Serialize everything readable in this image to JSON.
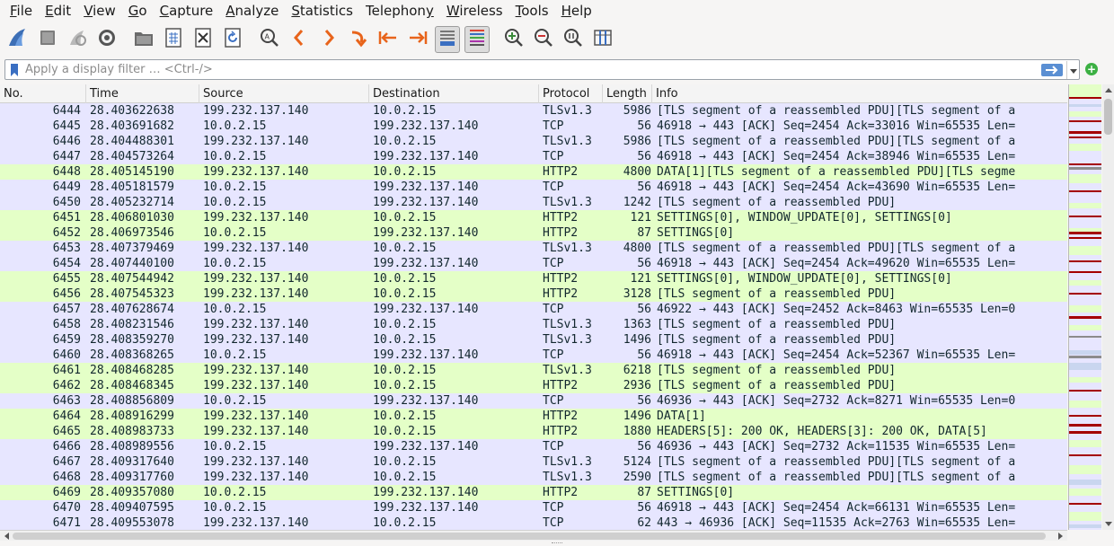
{
  "menu": [
    {
      "pre": "",
      "mn": "F",
      "post": "ile"
    },
    {
      "pre": "",
      "mn": "E",
      "post": "dit"
    },
    {
      "pre": "",
      "mn": "V",
      "post": "iew"
    },
    {
      "pre": "",
      "mn": "G",
      "post": "o"
    },
    {
      "pre": "",
      "mn": "C",
      "post": "apture"
    },
    {
      "pre": "",
      "mn": "A",
      "post": "nalyze"
    },
    {
      "pre": "",
      "mn": "S",
      "post": "tatistics"
    },
    {
      "pre": "Telephon",
      "mn": "y",
      "post": ""
    },
    {
      "pre": "",
      "mn": "W",
      "post": "ireless"
    },
    {
      "pre": "",
      "mn": "T",
      "post": "ools"
    },
    {
      "pre": "",
      "mn": "H",
      "post": "elp"
    }
  ],
  "filter": {
    "placeholder": "Apply a display filter … <Ctrl-/>"
  },
  "columns": {
    "no": "No.",
    "time": "Time",
    "source": "Source",
    "destination": "Destination",
    "protocol": "Protocol",
    "length": "Length",
    "info": "Info"
  },
  "colors": {
    "tcp_row": "#e7e6ff",
    "http2_row": "#e4ffc7",
    "text": "#12272e"
  },
  "packets": [
    {
      "no": "6444",
      "time": "28.403622638",
      "src": "199.232.137.140",
      "dst": "10.0.2.15",
      "proto": "TLSv1.3",
      "len": "5986",
      "info": "[TLS segment of a reassembled PDU][TLS segment of a",
      "kind": "tcp"
    },
    {
      "no": "6445",
      "time": "28.403691682",
      "src": "10.0.2.15",
      "dst": "199.232.137.140",
      "proto": "TCP",
      "len": "56",
      "info": "46918 → 443 [ACK] Seq=2454 Ack=33016 Win=65535 Len=",
      "kind": "tcp"
    },
    {
      "no": "6446",
      "time": "28.404488301",
      "src": "199.232.137.140",
      "dst": "10.0.2.15",
      "proto": "TLSv1.3",
      "len": "5986",
      "info": "[TLS segment of a reassembled PDU][TLS segment of a",
      "kind": "tcp"
    },
    {
      "no": "6447",
      "time": "28.404573264",
      "src": "10.0.2.15",
      "dst": "199.232.137.140",
      "proto": "TCP",
      "len": "56",
      "info": "46918 → 443 [ACK] Seq=2454 Ack=38946 Win=65535 Len=",
      "kind": "tcp"
    },
    {
      "no": "6448",
      "time": "28.405145190",
      "src": "199.232.137.140",
      "dst": "10.0.2.15",
      "proto": "HTTP2",
      "len": "4800",
      "info": "DATA[1][TLS segment of a reassembled PDU][TLS segme",
      "kind": "http2"
    },
    {
      "no": "6449",
      "time": "28.405181579",
      "src": "10.0.2.15",
      "dst": "199.232.137.140",
      "proto": "TCP",
      "len": "56",
      "info": "46918 → 443 [ACK] Seq=2454 Ack=43690 Win=65535 Len=",
      "kind": "tcp"
    },
    {
      "no": "6450",
      "time": "28.405232714",
      "src": "10.0.2.15",
      "dst": "199.232.137.140",
      "proto": "TLSv1.3",
      "len": "1242",
      "info": "[TLS segment of a reassembled PDU]",
      "kind": "tcp"
    },
    {
      "no": "6451",
      "time": "28.406801030",
      "src": "199.232.137.140",
      "dst": "10.0.2.15",
      "proto": "HTTP2",
      "len": "121",
      "info": "SETTINGS[0], WINDOW_UPDATE[0], SETTINGS[0]",
      "kind": "http2"
    },
    {
      "no": "6452",
      "time": "28.406973546",
      "src": "10.0.2.15",
      "dst": "199.232.137.140",
      "proto": "HTTP2",
      "len": "87",
      "info": "SETTINGS[0]",
      "kind": "http2"
    },
    {
      "no": "6453",
      "time": "28.407379469",
      "src": "199.232.137.140",
      "dst": "10.0.2.15",
      "proto": "TLSv1.3",
      "len": "4800",
      "info": "[TLS segment of a reassembled PDU][TLS segment of a",
      "kind": "tcp"
    },
    {
      "no": "6454",
      "time": "28.407440100",
      "src": "10.0.2.15",
      "dst": "199.232.137.140",
      "proto": "TCP",
      "len": "56",
      "info": "46918 → 443 [ACK] Seq=2454 Ack=49620 Win=65535 Len=",
      "kind": "tcp"
    },
    {
      "no": "6455",
      "time": "28.407544942",
      "src": "199.232.137.140",
      "dst": "10.0.2.15",
      "proto": "HTTP2",
      "len": "121",
      "info": "SETTINGS[0], WINDOW_UPDATE[0], SETTINGS[0]",
      "kind": "http2"
    },
    {
      "no": "6456",
      "time": "28.407545323",
      "src": "199.232.137.140",
      "dst": "10.0.2.15",
      "proto": "HTTP2",
      "len": "3128",
      "info": "[TLS segment of a reassembled PDU]",
      "kind": "http2"
    },
    {
      "no": "6457",
      "time": "28.407628674",
      "src": "10.0.2.15",
      "dst": "199.232.137.140",
      "proto": "TCP",
      "len": "56",
      "info": "46922 → 443 [ACK] Seq=2452 Ack=8463 Win=65535 Len=0",
      "kind": "tcp"
    },
    {
      "no": "6458",
      "time": "28.408231546",
      "src": "199.232.137.140",
      "dst": "10.0.2.15",
      "proto": "TLSv1.3",
      "len": "1363",
      "info": "[TLS segment of a reassembled PDU]",
      "kind": "tcp"
    },
    {
      "no": "6459",
      "time": "28.408359270",
      "src": "199.232.137.140",
      "dst": "10.0.2.15",
      "proto": "TLSv1.3",
      "len": "1496",
      "info": "[TLS segment of a reassembled PDU]",
      "kind": "tcp"
    },
    {
      "no": "6460",
      "time": "28.408368265",
      "src": "10.0.2.15",
      "dst": "199.232.137.140",
      "proto": "TCP",
      "len": "56",
      "info": "46918 → 443 [ACK] Seq=2454 Ack=52367 Win=65535 Len=",
      "kind": "tcp"
    },
    {
      "no": "6461",
      "time": "28.408468285",
      "src": "199.232.137.140",
      "dst": "10.0.2.15",
      "proto": "TLSv1.3",
      "len": "6218",
      "info": "[TLS segment of a reassembled PDU]",
      "kind": "http2"
    },
    {
      "no": "6462",
      "time": "28.408468345",
      "src": "199.232.137.140",
      "dst": "10.0.2.15",
      "proto": "HTTP2",
      "len": "2936",
      "info": "[TLS segment of a reassembled PDU]",
      "kind": "http2"
    },
    {
      "no": "6463",
      "time": "28.408856809",
      "src": "10.0.2.15",
      "dst": "199.232.137.140",
      "proto": "TCP",
      "len": "56",
      "info": "46936 → 443 [ACK] Seq=2732 Ack=8271 Win=65535 Len=0",
      "kind": "tcp"
    },
    {
      "no": "6464",
      "time": "28.408916299",
      "src": "199.232.137.140",
      "dst": "10.0.2.15",
      "proto": "HTTP2",
      "len": "1496",
      "info": "DATA[1]",
      "kind": "http2"
    },
    {
      "no": "6465",
      "time": "28.408983733",
      "src": "199.232.137.140",
      "dst": "10.0.2.15",
      "proto": "HTTP2",
      "len": "1880",
      "info": "HEADERS[5]: 200 OK, HEADERS[3]: 200 OK, DATA[5]",
      "kind": "http2"
    },
    {
      "no": "6466",
      "time": "28.408989556",
      "src": "10.0.2.15",
      "dst": "199.232.137.140",
      "proto": "TCP",
      "len": "56",
      "info": "46936 → 443 [ACK] Seq=2732 Ack=11535 Win=65535 Len=",
      "kind": "tcp"
    },
    {
      "no": "6467",
      "time": "28.409317640",
      "src": "199.232.137.140",
      "dst": "10.0.2.15",
      "proto": "TLSv1.3",
      "len": "5124",
      "info": "[TLS segment of a reassembled PDU][TLS segment of a",
      "kind": "tcp"
    },
    {
      "no": "6468",
      "time": "28.409317760",
      "src": "199.232.137.140",
      "dst": "10.0.2.15",
      "proto": "TLSv1.3",
      "len": "2590",
      "info": "[TLS segment of a reassembled PDU][TLS segment of a",
      "kind": "tcp"
    },
    {
      "no": "6469",
      "time": "28.409357080",
      "src": "10.0.2.15",
      "dst": "199.232.137.140",
      "proto": "HTTP2",
      "len": "87",
      "info": "SETTINGS[0]",
      "kind": "http2"
    },
    {
      "no": "6470",
      "time": "28.409407595",
      "src": "10.0.2.15",
      "dst": "199.232.137.140",
      "proto": "TCP",
      "len": "56",
      "info": "46918 → 443 [ACK] Seq=2454 Ack=66131 Win=65535 Len=",
      "kind": "tcp"
    },
    {
      "no": "6471",
      "time": "28.409553078",
      "src": "199.232.137.140",
      "dst": "10.0.2.15",
      "proto": "TCP",
      "len": "62",
      "info": "443 → 46936 [ACK] Seq=11535 Ack=2763 Win=65535 Len=",
      "kind": "tcp"
    }
  ]
}
